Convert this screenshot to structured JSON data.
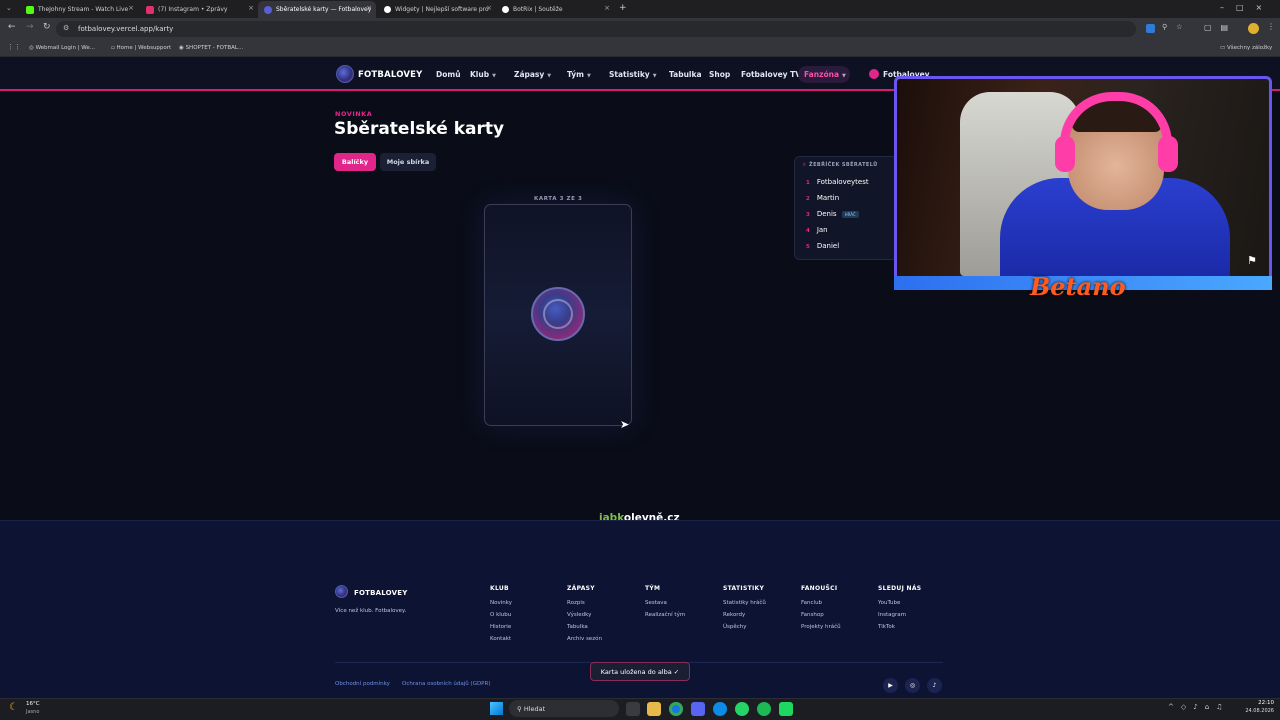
{
  "browser": {
    "tabs": [
      {
        "label": "TheJohny Stream - Watch Live",
        "color": "#53fc18"
      },
      {
        "label": "(7) Instagram • Zprávy",
        "color": "#e1306c"
      },
      {
        "label": "Sběratelské karty — Fotbalovey",
        "color": "#5a5fd6"
      },
      {
        "label": "Widgety | Nejlepší software pro",
        "color": "#ffffff"
      },
      {
        "label": "BotRix | Soutěže",
        "color": "#ffffff"
      }
    ],
    "new_tab": "+",
    "close": "×",
    "url": "fotbalovey.vercel.app/karty",
    "bookmarks": [
      "Webmail Login | We...",
      "Home | Websupport",
      "SHOPTET - FOTBAL..."
    ],
    "all_bookmarks": "Všechny záložky"
  },
  "site": {
    "brand": "FOTBALOVEY",
    "nav": [
      "Domů",
      "Klub",
      "Zápasy",
      "Tým",
      "Statistiky",
      "Tabulka",
      "Shop",
      "Fotbalovey TV",
      "Fanzóna"
    ],
    "nav_dropdown": [
      false,
      true,
      true,
      true,
      true,
      false,
      false,
      false,
      true
    ],
    "user_label": "Fotbalovey"
  },
  "main": {
    "kicker": "NOVINKA",
    "title": "Sběratelské karty",
    "tab_packs": "Balíčky",
    "tab_collection": "Moje sbírka",
    "card_counter": "KARTA 3 ZE 3"
  },
  "leaderboard": {
    "title": "ŽEBŘÍČEK SBĚRATELŮ",
    "rows": [
      {
        "rank": "1",
        "name": "Fotbaloveytest",
        "badge": ""
      },
      {
        "rank": "2",
        "name": "Martin",
        "badge": ""
      },
      {
        "rank": "3",
        "name": "Denis",
        "badge": "HRÁČ"
      },
      {
        "rank": "4",
        "name": "Jan",
        "badge": ""
      },
      {
        "rank": "5",
        "name": "Daniel",
        "badge": ""
      }
    ]
  },
  "stream": {
    "sponsor": "Betano"
  },
  "sponsor": {
    "part1": "jabk",
    "part2": "olevně.cz"
  },
  "footer": {
    "brand": "FOTBALOVEY",
    "tagline": "Více než klub. Fotbalovey.",
    "columns": [
      {
        "heading": "KLUB",
        "links": [
          "Novinky",
          "O klubu",
          "Historie",
          "Kontakt"
        ]
      },
      {
        "heading": "ZÁPASY",
        "links": [
          "Rozpis",
          "Výsledky",
          "Tabulka",
          "Archiv sezón"
        ]
      },
      {
        "heading": "TÝM",
        "links": [
          "Sestava",
          "Realizační tým"
        ]
      },
      {
        "heading": "STATISTIKY",
        "links": [
          "Statistiky hráčů",
          "Rekordy",
          "Úspěchy"
        ]
      },
      {
        "heading": "FANOUŠCI",
        "links": [
          "Fanclub",
          "Fanshop",
          "Projekty hráčů"
        ]
      },
      {
        "heading": "SLEDUJ NÁS",
        "links": [
          "YouTube",
          "Instagram",
          "TikTok"
        ]
      }
    ],
    "legal": [
      "Obchodní podmínky",
      "Ochrana osobních údajů (GDPR)"
    ],
    "toast": "Karta uložena do alba ✓"
  },
  "taskbar": {
    "weather_temp": "16°C",
    "weather_desc": "Jasno",
    "search": "Hledat",
    "time": "22:10",
    "date": "24.08.2026"
  }
}
